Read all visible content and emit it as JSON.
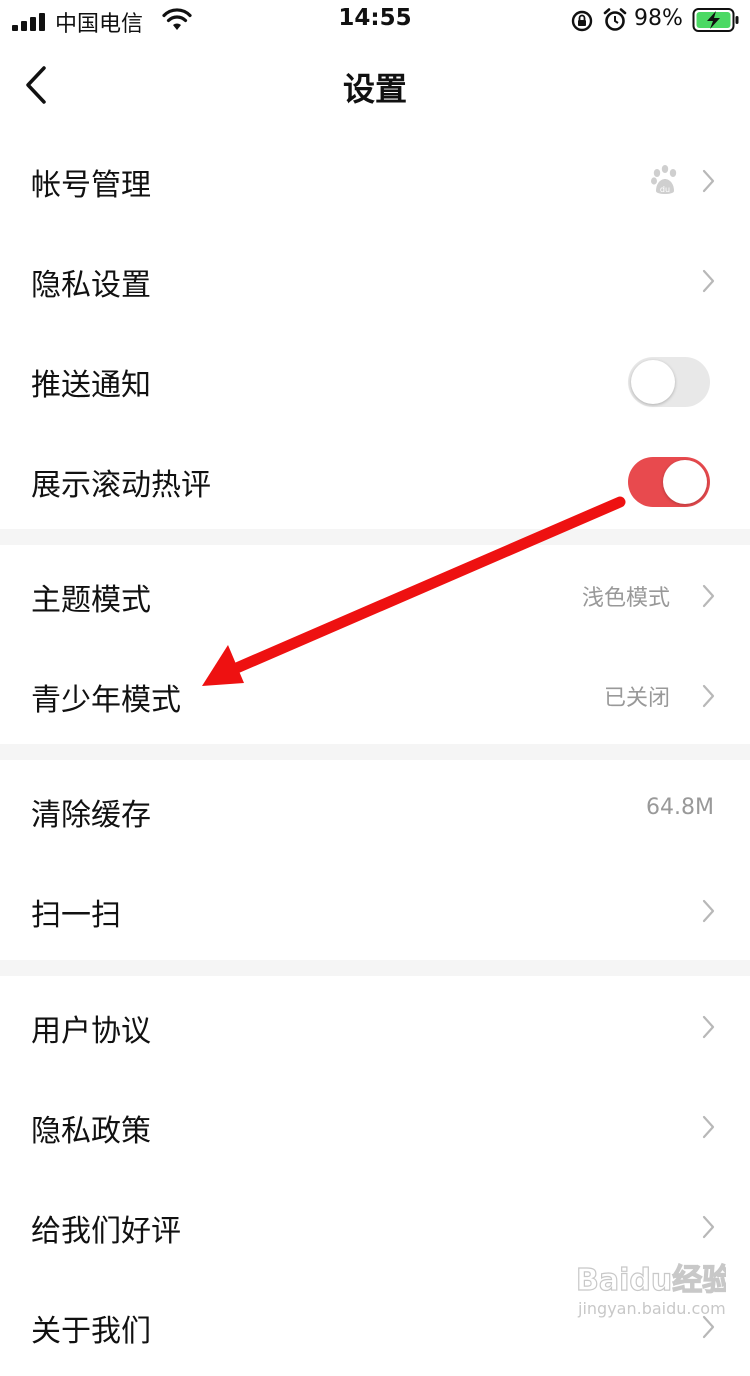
{
  "status_bar": {
    "carrier": "中国电信",
    "time": "14:55",
    "battery": "98%"
  },
  "header": {
    "title": "设置"
  },
  "groups": {
    "account": {
      "account_management": {
        "label": "帐号管理"
      },
      "privacy_settings": {
        "label": "隐私设置"
      },
      "push_notifications": {
        "label": "推送通知",
        "enabled": false
      },
      "scrolling_comments": {
        "label": "展示滚动热评",
        "enabled": true
      }
    },
    "display": {
      "theme_mode": {
        "label": "主题模式",
        "value": "浅色模式"
      },
      "teen_mode": {
        "label": "青少年模式",
        "value": "已关闭"
      }
    },
    "tools": {
      "clear_cache": {
        "label": "清除缓存",
        "value": "64.8M"
      },
      "scan": {
        "label": "扫一扫"
      }
    },
    "about": {
      "user_agreement": {
        "label": "用户协议"
      },
      "privacy_policy": {
        "label": "隐私政策"
      },
      "rate_us": {
        "label": "给我们好评"
      },
      "about_us": {
        "label": "关于我们"
      }
    }
  },
  "watermark": {
    "brand": "Baidu经验",
    "url": "jingyan.baidu.com"
  },
  "colors": {
    "accent": "#e84a4e",
    "toggle_off": "#e8e8e8",
    "divider": "#f5f5f5",
    "value_text": "#999999",
    "annotation_arrow": "#ee1111"
  },
  "icons": {
    "back": "chevron-left-icon",
    "account_link": "baidu-paw-icon",
    "row_chevron": "chevron-right-icon"
  }
}
